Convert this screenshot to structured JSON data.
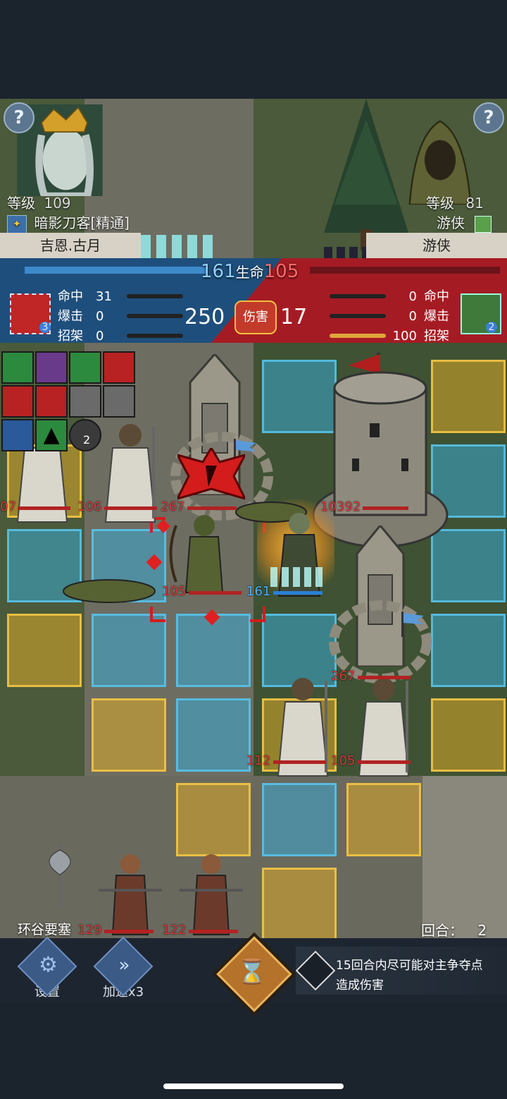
{
  "player": {
    "level_label": "等级",
    "level": "109",
    "class": "暗影刀客[精通]",
    "name": "吉恩.古月"
  },
  "enemy": {
    "level_label": "等级",
    "level": "81",
    "class": "游侠",
    "name": "游侠"
  },
  "combat": {
    "player_hp": "161",
    "hp_label": "生命",
    "enemy_hp": "105",
    "damage_label": "伤害",
    "player_damage": "250",
    "enemy_damage": "17",
    "player_stats": [
      {
        "label": "命中",
        "value": "31"
      },
      {
        "label": "爆击",
        "value": "0"
      },
      {
        "label": "招架",
        "value": "0"
      }
    ],
    "enemy_stats": [
      {
        "label": "命中",
        "value": "0"
      },
      {
        "label": "爆击",
        "value": "0"
      },
      {
        "label": "招架",
        "value": "100"
      }
    ],
    "player_skill_badge": "3",
    "enemy_skill_badge": "2"
  },
  "skill_grid_badge": "2",
  "units": {
    "hp": [
      "07",
      "106",
      "267",
      "10392",
      "105",
      "161",
      "267",
      "112",
      "105",
      "129",
      "122"
    ]
  },
  "footer": {
    "location": "环谷要塞",
    "round_label": "回合：",
    "round": "2",
    "settings_label": "设置",
    "speed_label": "加速x3",
    "objective_line1": "15回合内尽可能对主争夺点",
    "objective_line2": "造成伤害"
  },
  "colors": {
    "player_side": "#1e4f7c",
    "enemy_side": "#a51b24",
    "tile_blue": "#3aaad2",
    "tile_yellow": "#dcaa28"
  }
}
